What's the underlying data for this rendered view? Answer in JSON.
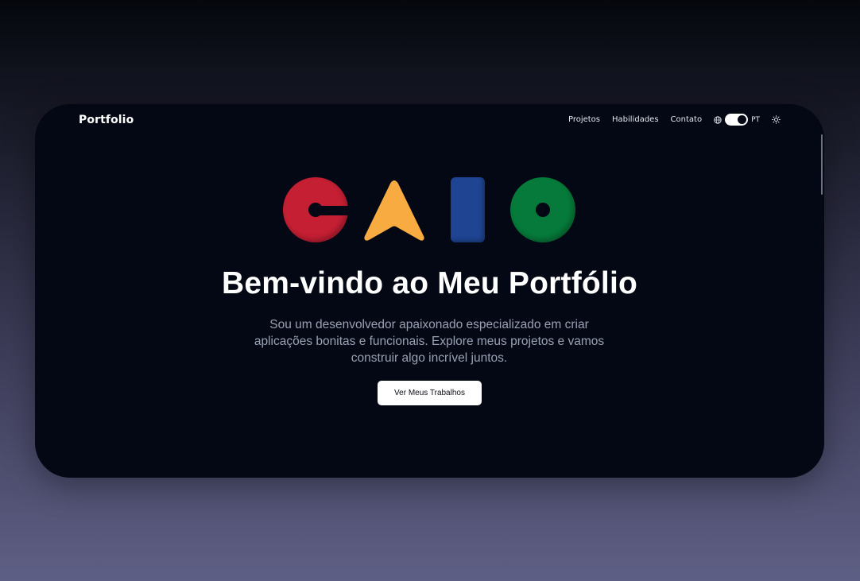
{
  "nav": {
    "brand": "Portfolio",
    "links": [
      "Projetos",
      "Habilidades",
      "Contato"
    ],
    "language": {
      "label": "PT",
      "icon": "globe-icon",
      "toggle_on": true
    },
    "theme_icon": "sun-icon"
  },
  "logo": {
    "letters": [
      "C",
      "A",
      "I",
      "O"
    ],
    "colors": {
      "c": "#c41f33",
      "a": "#f8ab41",
      "i": "#1e4492",
      "o": "#057a3a"
    }
  },
  "hero": {
    "title": "Bem-vindo ao Meu Portfólio",
    "subtitle": "Sou um desenvolvedor apaixonado especializado em criar aplicações bonitas e funcionais. Explore meus projetos e vamos construir algo incrível juntos.",
    "cta_label": "Ver Meus Trabalhos"
  },
  "colors": {
    "window_bg": "#030814",
    "text": "#ffffff",
    "muted_text": "#9aa1b3"
  }
}
